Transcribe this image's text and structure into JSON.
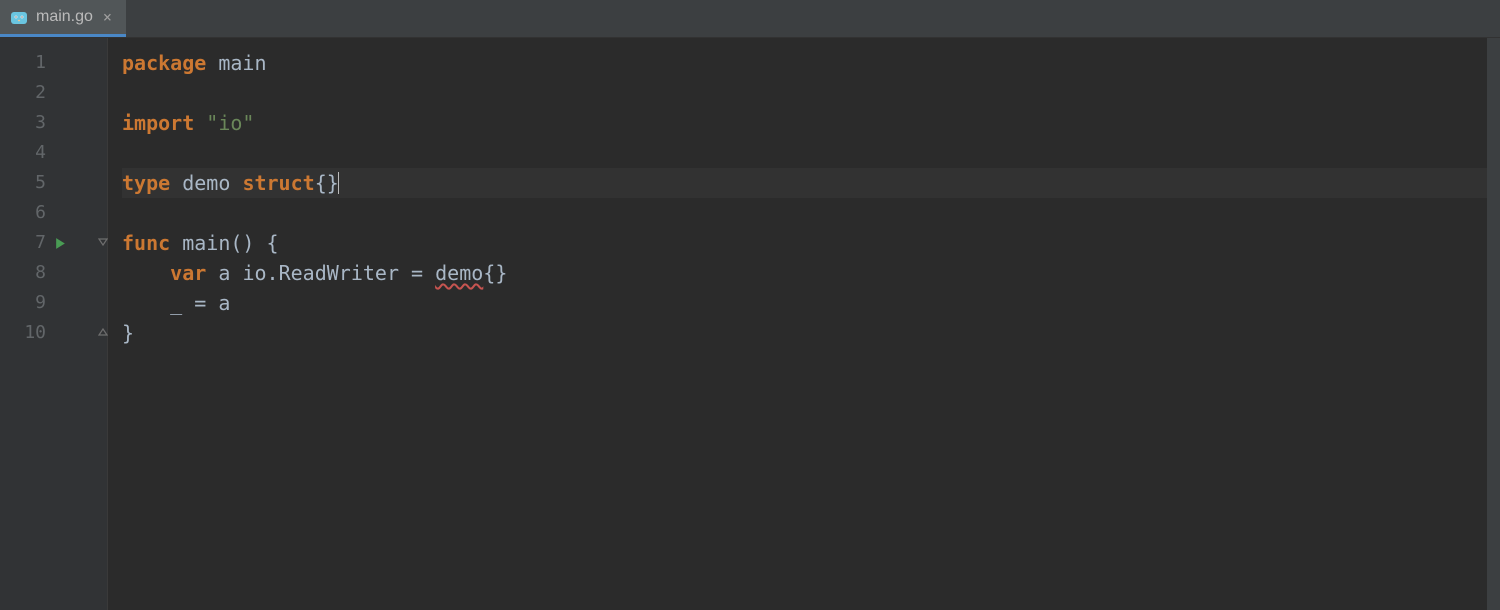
{
  "tab": {
    "filename": "main.go",
    "close_glyph": "×"
  },
  "lines": {
    "count": 10,
    "current": 5,
    "run_marker_at": 7,
    "fold_open_at": 7,
    "fold_close_at": 10
  },
  "code": {
    "l1": {
      "kw": "package",
      "id": "main"
    },
    "l3": {
      "kw": "import",
      "str": "\"io\""
    },
    "l5": {
      "kw1": "type",
      "id": "demo",
      "kw2": "struct",
      "braces": "{}"
    },
    "l7": {
      "kw": "func",
      "id": "main",
      "parens": "()",
      "brace": "{"
    },
    "l8": {
      "indent": "    ",
      "kw": "var",
      "a": "a",
      "pkg": "io",
      "dot": ".",
      "type": "ReadWriter",
      "eq": " = ",
      "ctor": "demo",
      "braces": "{}"
    },
    "l9": {
      "indent": "    ",
      "blank": "_",
      "eq": " = ",
      "a": "a"
    },
    "l10": {
      "brace": "}"
    }
  }
}
